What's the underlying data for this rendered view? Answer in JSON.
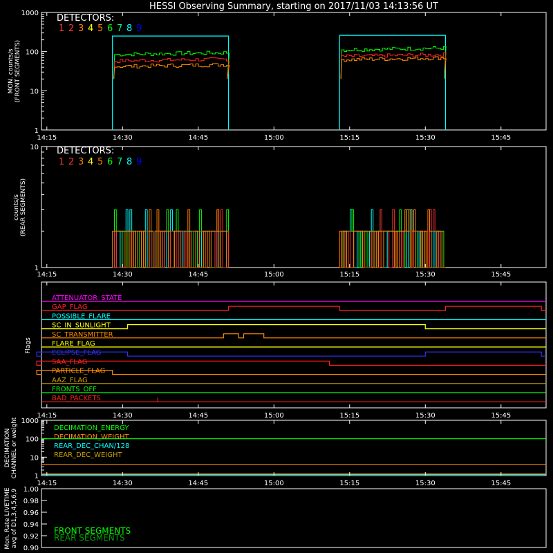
{
  "title": "HESSI Observing Summary, starting on 2017/11/03 14:13:56 UT",
  "colors": {
    "axis": "#ffffff",
    "det": [
      "#ff3030",
      "#ff3030",
      "#ff7f00",
      "#ffff00",
      "#ff7f00",
      "#00ff00",
      "#00ff7f",
      "#00ffff",
      "#0000ff"
    ],
    "front_lines": {
      "cyan": "#00ffff",
      "green": "#00ff00",
      "red": "#ff2020",
      "orange": "#ff8c00",
      "light": "#ff6060"
    },
    "rear_lines": {
      "cyan": "#00ffff",
      "green": "#00ff00",
      "red": "#ff3030",
      "orange": "#ff7f00"
    }
  },
  "x_axis": {
    "tick_labels": [
      "14:15",
      "14:30",
      "14:45",
      "15:00",
      "15:15",
      "15:30",
      "15:45"
    ]
  },
  "panels": {
    "front": {
      "ylabel": [
        "MON. counts/s",
        "(FRONT SEGMENTS)"
      ],
      "tick_labels": [
        "1",
        "10",
        "100",
        "1000"
      ],
      "detectors_label": "DETECTORS:",
      "detector_numbers": [
        "1",
        "2",
        "3",
        "4",
        "5",
        "6",
        "7",
        "8",
        "9"
      ]
    },
    "rear": {
      "ylabel": [
        "counts/s",
        "(REAR SEGMENTS)"
      ],
      "tick_labels": [
        "1",
        "10"
      ],
      "detectors_label": "DETECTORS:",
      "detector_numbers": [
        "1",
        "2",
        "3",
        "4",
        "5",
        "6",
        "7",
        "8",
        "9"
      ]
    },
    "flags": {
      "ylabel": "Flags",
      "items": [
        {
          "label": "ATTENUATOR_STATE",
          "color": "#ff00ff"
        },
        {
          "label": "GAP_FLAG",
          "color": "#ff2020"
        },
        {
          "label": "POSSIBLE_FLARE",
          "color": "#00ffff"
        },
        {
          "label": "SC_IN_SUNLIGHT",
          "color": "#ffff00"
        },
        {
          "label": "SC_TRANSMITTER",
          "color": "#ff8c00"
        },
        {
          "label": "FLARE_FLAG",
          "color": "#ffff00"
        },
        {
          "label": "ECLIPSE_FLAG",
          "color": "#3030ff"
        },
        {
          "label": "SAA_FLAG",
          "color": "#ff2020"
        },
        {
          "label": "PARTICLE_FLAG",
          "color": "#ff8c00"
        },
        {
          "label": "AAZ_FLAG",
          "color": "#c8a000"
        },
        {
          "label": "FRONTS_OFF",
          "color": "#00ff00"
        },
        {
          "label": "BAD_PACKETS",
          "color": "#ff2020"
        }
      ]
    },
    "decimation": {
      "ylabel": [
        "DECIMATION",
        "CHANNEL or weight"
      ],
      "tick_labels": [
        "1",
        "10",
        "100",
        "1000"
      ],
      "legend": [
        {
          "label": "DECIMATION_ENERGY",
          "color": "#00ff00"
        },
        {
          "label": "DECIMATION_WEIGHT",
          "color": "#ff8c00"
        },
        {
          "label": "REAR_DEC_CHAN/128",
          "color": "#00ffff"
        },
        {
          "label": "REAR_DEC_WEIGHT",
          "color": "#c8a000"
        }
      ]
    },
    "livetime": {
      "ylabel": [
        "Mon. Rate LIVETIME",
        "avg of D1,3,4,5,6,9"
      ],
      "tick_labels": [
        "0.90",
        "0.92",
        "0.94",
        "0.96",
        "0.98",
        "1.00"
      ],
      "legend": [
        {
          "label": "FRONT SEGMENTS",
          "color": "#00ff00"
        },
        {
          "label": "REAR SEGMENTS",
          "color": "#00a000"
        }
      ]
    }
  },
  "chart_data": {
    "type": "line",
    "title": "HESSI Observing Summary, starting on 2017/11/03 14:13:56 UT",
    "x_range": [
      "14:13:56",
      "15:53:56"
    ],
    "front_counts": {
      "yscale": "log",
      "ylim": [
        1,
        1000
      ],
      "segments": [
        {
          "start": "14:28",
          "end": "14:51",
          "levels": {
            "cyan": 250,
            "green": 95,
            "red": 65,
            "orange": 47
          }
        },
        {
          "start": "15:13",
          "end": "15:34",
          "levels": {
            "cyan": 260,
            "green": 125,
            "red": 85,
            "orange": 70
          }
        }
      ]
    },
    "rear_counts": {
      "yscale": "log",
      "ylim": [
        1,
        10
      ],
      "segments": [
        {
          "start": "14:28",
          "end": "14:51",
          "base": 2,
          "peak": 3
        },
        {
          "start": "15:13",
          "end": "15:34",
          "base": 2,
          "peak": 3
        }
      ]
    },
    "flags": {
      "GAP_FLAG": [
        [
          "14:51",
          "15:13"
        ],
        [
          "15:34",
          "15:53"
        ]
      ],
      "SC_IN_SUNLIGHT": [
        [
          "14:31",
          "15:30"
        ]
      ],
      "SC_TRANSMITTER": [
        [
          "14:50",
          "14:53"
        ],
        [
          "14:54",
          "14:58"
        ]
      ],
      "ECLIPSE_FLAG": [
        [
          "14:13",
          "14:31"
        ],
        [
          "15:30",
          "15:53"
        ]
      ],
      "SAA_FLAG": [
        [
          "14:13",
          "15:11"
        ]
      ],
      "PARTICLE_FLAG": [
        [
          "14:13",
          "14:28"
        ]
      ],
      "BAD_PACKETS": [
        [
          "14:37",
          "14:37"
        ]
      ]
    },
    "decimation": {
      "yscale": "log",
      "ylim": [
        1,
        1000
      ],
      "DECIMATION_ENERGY": 100,
      "DECIMATION_WEIGHT": 4,
      "REAR_DEC_CHAN/128": 1,
      "REAR_DEC_WEIGHT": 1
    },
    "livetime": {
      "ylim": [
        0.9,
        1.0
      ]
    }
  }
}
